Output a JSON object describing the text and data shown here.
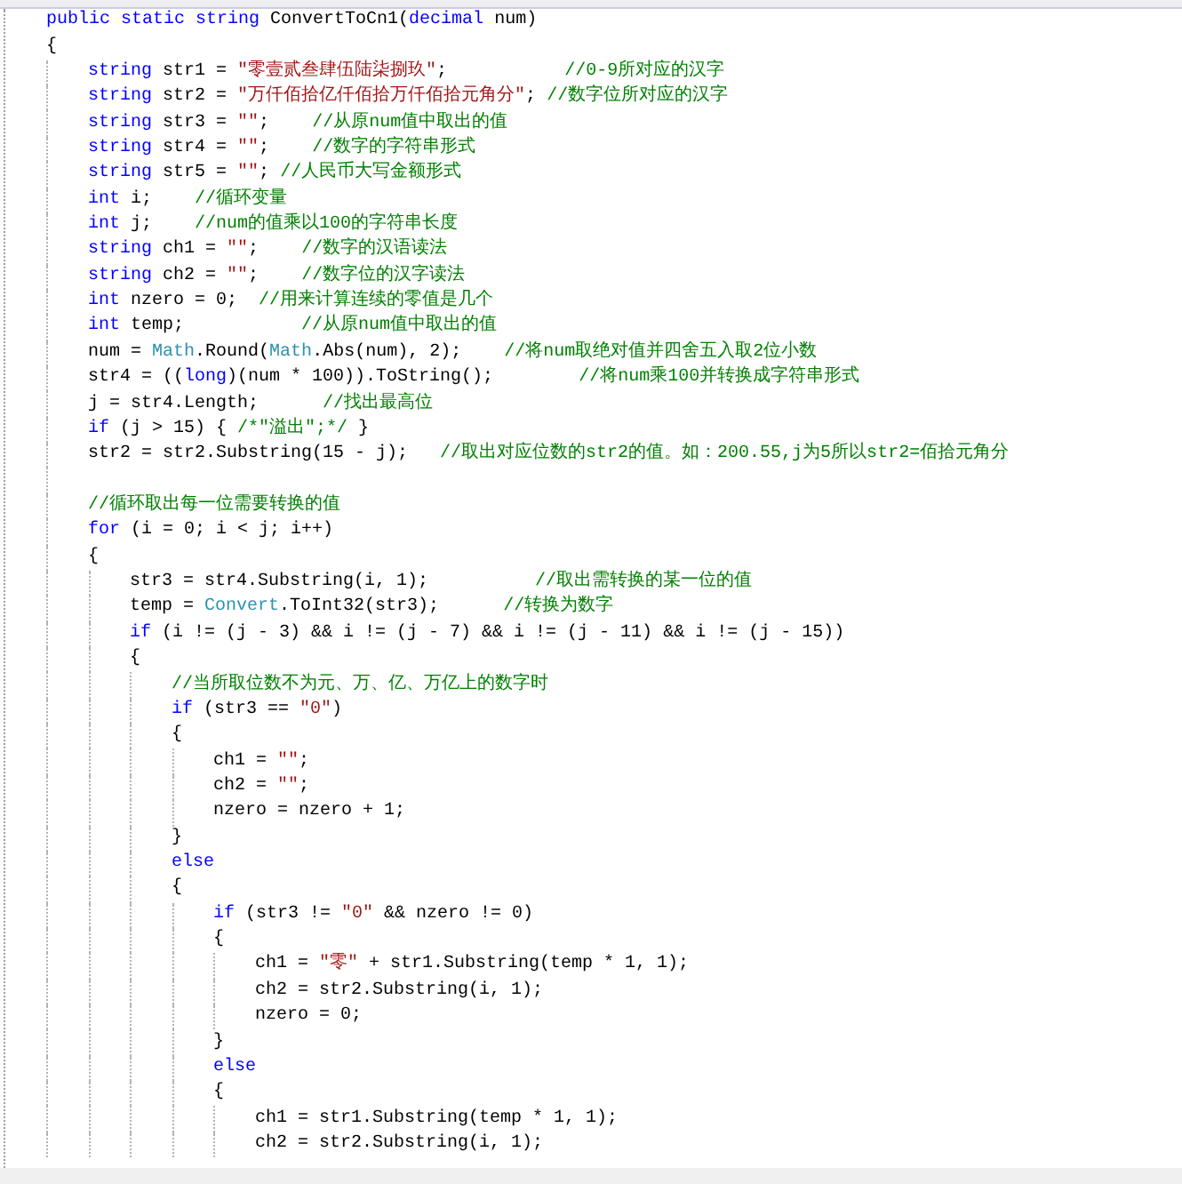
{
  "editor": {
    "lines": [
      {
        "kind": "code",
        "parts": [
          {
            "kind": "kw",
            "text": "public static string "
          },
          {
            "kind": "tx",
            "text": "ConvertToCn1("
          },
          {
            "kind": "kw",
            "text": "decimal"
          },
          {
            "kind": "tx",
            "text": " num)"
          }
        ]
      },
      {
        "kind": "code",
        "parts": [
          {
            "kind": "tx",
            "text": "{"
          }
        ],
        "children": [
          {
            "kind": "code",
            "parts": [
              {
                "kind": "kw",
                "text": "string"
              },
              {
                "kind": "tx",
                "text": " str1 = "
              },
              {
                "kind": "str",
                "text": "\"零壹贰叁肆伍陆柒捌玖\""
              },
              {
                "kind": "tx",
                "text": ";           "
              },
              {
                "kind": "cm",
                "text": "//0-9所对应的汉字"
              }
            ]
          },
          {
            "kind": "code",
            "parts": [
              {
                "kind": "kw",
                "text": "string"
              },
              {
                "kind": "tx",
                "text": " str2 = "
              },
              {
                "kind": "str",
                "text": "\"万仟佰拾亿仟佰拾万仟佰拾元角分\""
              },
              {
                "kind": "tx",
                "text": "; "
              },
              {
                "kind": "cm",
                "text": "//数字位所对应的汉字"
              }
            ]
          },
          {
            "kind": "code",
            "parts": [
              {
                "kind": "kw",
                "text": "string"
              },
              {
                "kind": "tx",
                "text": " str3 = "
              },
              {
                "kind": "str",
                "text": "\"\""
              },
              {
                "kind": "tx",
                "text": ";    "
              },
              {
                "kind": "cm",
                "text": "//从原num值中取出的值"
              }
            ]
          },
          {
            "kind": "code",
            "parts": [
              {
                "kind": "kw",
                "text": "string"
              },
              {
                "kind": "tx",
                "text": " str4 = "
              },
              {
                "kind": "str",
                "text": "\"\""
              },
              {
                "kind": "tx",
                "text": ";    "
              },
              {
                "kind": "cm",
                "text": "//数字的字符串形式"
              }
            ]
          },
          {
            "kind": "code",
            "parts": [
              {
                "kind": "kw",
                "text": "string"
              },
              {
                "kind": "tx",
                "text": " str5 = "
              },
              {
                "kind": "str",
                "text": "\"\""
              },
              {
                "kind": "tx",
                "text": "; "
              },
              {
                "kind": "cm",
                "text": "//人民币大写金额形式"
              }
            ]
          },
          {
            "kind": "code",
            "parts": [
              {
                "kind": "kw",
                "text": "int"
              },
              {
                "kind": "tx",
                "text": " i;    "
              },
              {
                "kind": "cm",
                "text": "//循环变量"
              }
            ]
          },
          {
            "kind": "code",
            "parts": [
              {
                "kind": "kw",
                "text": "int"
              },
              {
                "kind": "tx",
                "text": " j;    "
              },
              {
                "kind": "cm",
                "text": "//num的值乘以100的字符串长度"
              }
            ]
          },
          {
            "kind": "code",
            "parts": [
              {
                "kind": "kw",
                "text": "string"
              },
              {
                "kind": "tx",
                "text": " ch1 = "
              },
              {
                "kind": "str",
                "text": "\"\""
              },
              {
                "kind": "tx",
                "text": ";    "
              },
              {
                "kind": "cm",
                "text": "//数字的汉语读法"
              }
            ]
          },
          {
            "kind": "code",
            "parts": [
              {
                "kind": "kw",
                "text": "string"
              },
              {
                "kind": "tx",
                "text": " ch2 = "
              },
              {
                "kind": "str",
                "text": "\"\""
              },
              {
                "kind": "tx",
                "text": ";    "
              },
              {
                "kind": "cm",
                "text": "//数字位的汉字读法"
              }
            ]
          },
          {
            "kind": "code",
            "parts": [
              {
                "kind": "kw",
                "text": "int"
              },
              {
                "kind": "tx",
                "text": " nzero = 0;  "
              },
              {
                "kind": "cm",
                "text": "//用来计算连续的零值是几个"
              }
            ]
          },
          {
            "kind": "code",
            "parts": [
              {
                "kind": "kw",
                "text": "int"
              },
              {
                "kind": "tx",
                "text": " temp;           "
              },
              {
                "kind": "cm",
                "text": "//从原num值中取出的值"
              }
            ]
          },
          {
            "kind": "code",
            "parts": [
              {
                "kind": "tx",
                "text": "num = "
              },
              {
                "kind": "type",
                "text": "Math"
              },
              {
                "kind": "tx",
                "text": ".Round("
              },
              {
                "kind": "type",
                "text": "Math"
              },
              {
                "kind": "tx",
                "text": ".Abs(num), 2);    "
              },
              {
                "kind": "cm",
                "text": "//将num取绝对值并四舍五入取2位小数"
              }
            ]
          },
          {
            "kind": "code",
            "parts": [
              {
                "kind": "tx",
                "text": "str4 = (("
              },
              {
                "kind": "kw",
                "text": "long"
              },
              {
                "kind": "tx",
                "text": ")(num * 100)).ToString();        "
              },
              {
                "kind": "cm",
                "text": "//将num乘100并转换成字符串形式"
              }
            ]
          },
          {
            "kind": "code",
            "parts": [
              {
                "kind": "tx",
                "text": "j = str4.Length;      "
              },
              {
                "kind": "cm",
                "text": "//找出最高位"
              }
            ]
          },
          {
            "kind": "code",
            "parts": [
              {
                "kind": "kw",
                "text": "if"
              },
              {
                "kind": "tx",
                "text": " (j > 15) { "
              },
              {
                "kind": "cm",
                "text": "/*\"溢出\";*/"
              },
              {
                "kind": "tx",
                "text": " }"
              }
            ]
          },
          {
            "kind": "code",
            "parts": [
              {
                "kind": "tx",
                "text": "str2 = str2.Substring(15 - j);   "
              },
              {
                "kind": "cm",
                "text": "//取出对应位数的str2的值。如：200.55,j为5所以str2=佰拾元角分"
              }
            ]
          },
          {
            "kind": "blank"
          },
          {
            "kind": "code",
            "parts": [
              {
                "kind": "cm",
                "text": "//循环取出每一位需要转换的值"
              }
            ]
          },
          {
            "kind": "code",
            "parts": [
              {
                "kind": "kw",
                "text": "for"
              },
              {
                "kind": "tx",
                "text": " (i = 0; i < j; i++)"
              }
            ]
          },
          {
            "kind": "code",
            "parts": [
              {
                "kind": "tx",
                "text": "{"
              }
            ],
            "children": [
              {
                "kind": "code",
                "parts": [
                  {
                    "kind": "tx",
                    "text": "str3 = str4.Substring(i, 1);          "
                  },
                  {
                    "kind": "cm",
                    "text": "//取出需转换的某一位的值"
                  }
                ]
              },
              {
                "kind": "code",
                "parts": [
                  {
                    "kind": "tx",
                    "text": "temp = "
                  },
                  {
                    "kind": "type",
                    "text": "Convert"
                  },
                  {
                    "kind": "tx",
                    "text": ".ToInt32(str3);      "
                  },
                  {
                    "kind": "cm",
                    "text": "//转换为数字"
                  }
                ]
              },
              {
                "kind": "code",
                "parts": [
                  {
                    "kind": "kw",
                    "text": "if"
                  },
                  {
                    "kind": "tx",
                    "text": " (i != (j - 3) && i != (j - 7) && i != (j - 11) && i != (j - 15))"
                  }
                ]
              },
              {
                "kind": "code",
                "parts": [
                  {
                    "kind": "tx",
                    "text": "{"
                  }
                ],
                "children": [
                  {
                    "kind": "code",
                    "parts": [
                      {
                        "kind": "cm",
                        "text": "//当所取位数不为元、万、亿、万亿上的数字时"
                      }
                    ]
                  },
                  {
                    "kind": "code",
                    "parts": [
                      {
                        "kind": "kw",
                        "text": "if"
                      },
                      {
                        "kind": "tx",
                        "text": " (str3 == "
                      },
                      {
                        "kind": "str",
                        "text": "\"0\""
                      },
                      {
                        "kind": "tx",
                        "text": ")"
                      }
                    ]
                  },
                  {
                    "kind": "code",
                    "parts": [
                      {
                        "kind": "tx",
                        "text": "{"
                      }
                    ],
                    "children": [
                      {
                        "kind": "code",
                        "parts": [
                          {
                            "kind": "tx",
                            "text": "ch1 = "
                          },
                          {
                            "kind": "str",
                            "text": "\"\""
                          },
                          {
                            "kind": "tx",
                            "text": ";"
                          }
                        ]
                      },
                      {
                        "kind": "code",
                        "parts": [
                          {
                            "kind": "tx",
                            "text": "ch2 = "
                          },
                          {
                            "kind": "str",
                            "text": "\"\""
                          },
                          {
                            "kind": "tx",
                            "text": ";"
                          }
                        ]
                      },
                      {
                        "kind": "code",
                        "parts": [
                          {
                            "kind": "tx",
                            "text": "nzero = nzero + 1;"
                          }
                        ]
                      }
                    ]
                  },
                  {
                    "kind": "code",
                    "parts": [
                      {
                        "kind": "tx",
                        "text": "}"
                      }
                    ]
                  },
                  {
                    "kind": "code",
                    "parts": [
                      {
                        "kind": "kw",
                        "text": "else"
                      }
                    ]
                  },
                  {
                    "kind": "code",
                    "parts": [
                      {
                        "kind": "tx",
                        "text": "{"
                      }
                    ],
                    "children": [
                      {
                        "kind": "code",
                        "parts": [
                          {
                            "kind": "kw",
                            "text": "if"
                          },
                          {
                            "kind": "tx",
                            "text": " (str3 != "
                          },
                          {
                            "kind": "str",
                            "text": "\"0\""
                          },
                          {
                            "kind": "tx",
                            "text": " && nzero != 0)"
                          }
                        ]
                      },
                      {
                        "kind": "code",
                        "parts": [
                          {
                            "kind": "tx",
                            "text": "{"
                          }
                        ],
                        "children": [
                          {
                            "kind": "code",
                            "parts": [
                              {
                                "kind": "tx",
                                "text": "ch1 = "
                              },
                              {
                                "kind": "str",
                                "text": "\"零\""
                              },
                              {
                                "kind": "tx",
                                "text": " + str1.Substring(temp * 1, 1);"
                              }
                            ]
                          },
                          {
                            "kind": "code",
                            "parts": [
                              {
                                "kind": "tx",
                                "text": "ch2 = str2.Substring(i, 1);"
                              }
                            ]
                          },
                          {
                            "kind": "code",
                            "parts": [
                              {
                                "kind": "tx",
                                "text": "nzero = 0;"
                              }
                            ]
                          }
                        ]
                      },
                      {
                        "kind": "code",
                        "parts": [
                          {
                            "kind": "tx",
                            "text": "}"
                          }
                        ]
                      },
                      {
                        "kind": "code",
                        "parts": [
                          {
                            "kind": "kw",
                            "text": "else"
                          }
                        ]
                      },
                      {
                        "kind": "code",
                        "parts": [
                          {
                            "kind": "tx",
                            "text": "{"
                          }
                        ],
                        "children": [
                          {
                            "kind": "code",
                            "parts": [
                              {
                                "kind": "tx",
                                "text": "ch1 = str1.Substring(temp * 1, 1);"
                              }
                            ]
                          },
                          {
                            "kind": "code",
                            "parts": [
                              {
                                "kind": "tx",
                                "text": "ch2 = str2.Substring(i, 1);"
                              }
                            ]
                          }
                        ]
                      }
                    ]
                  }
                ]
              }
            ]
          }
        ]
      }
    ]
  }
}
